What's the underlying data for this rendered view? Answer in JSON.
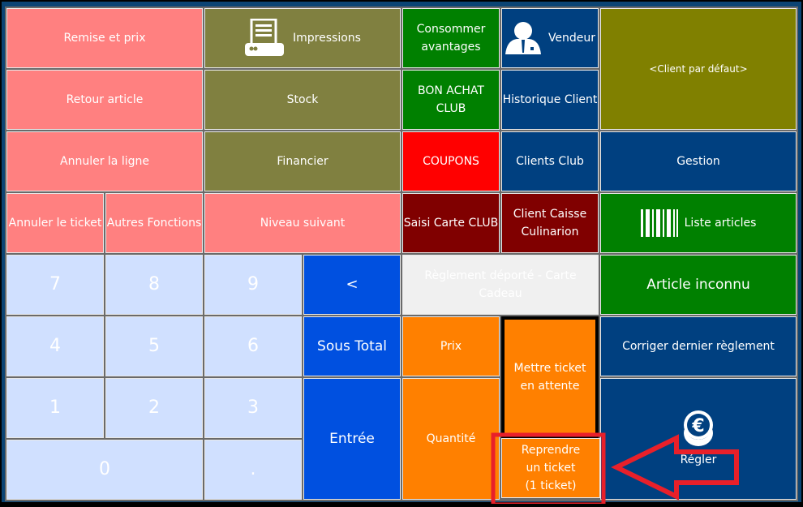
{
  "buttons": {
    "remise": "Remise et prix",
    "impressions": "Impressions",
    "consommer": "Consommer avantages",
    "vendeur": "Vendeur",
    "client_defaut": "<Client par défaut>",
    "retour": "Retour article",
    "stock": "Stock",
    "bon_achat": "BON ACHAT CLUB",
    "historique": "Historique Client",
    "annuler_ligne": "Annuler la ligne",
    "financier": "Financier",
    "coupons": "COUPONS",
    "clients_club": "Clients Club",
    "gestion": "Gestion",
    "annuler_ticket": "Annuler le ticket",
    "autres": "Autres Fonctions",
    "niveau": "Niveau suivant",
    "saisi_carte": "Saisi Carte CLUB",
    "client_caisse": "Client Caisse Culinarion",
    "liste_articles": "Liste articles",
    "back": "<",
    "reglement_deporte": "Règlement déporté - Carte Cadeau",
    "article_inconnu": "Article inconnu",
    "sous_total": "Sous Total",
    "prix": "Prix",
    "mettre_attente": "Mettre ticket en attente",
    "corriger": "Corriger dernier règlement",
    "entree": "Entrée",
    "quantite": "Quantité",
    "regler": "Régler",
    "reprendre": "Reprendre un ticket",
    "reprendre_count": "(1 ticket)",
    "dot": "."
  },
  "keypad": [
    "7",
    "8",
    "9",
    "4",
    "5",
    "6",
    "1",
    "2",
    "3",
    "0"
  ],
  "icons": {
    "impressions": "printer-icon",
    "vendeur": "user-tie-icon",
    "liste": "barcode-icon",
    "regler": "euro-coins-icon"
  },
  "colors": {
    "pink": "#ff8080",
    "olive": "#808040",
    "green": "#008000",
    "navy": "#004080",
    "red": "#ff0000",
    "maroon": "#800000",
    "orange": "#ff8000",
    "keypad": "#d0e0ff",
    "blue": "#0050e0",
    "annotation": "#e8202a"
  }
}
